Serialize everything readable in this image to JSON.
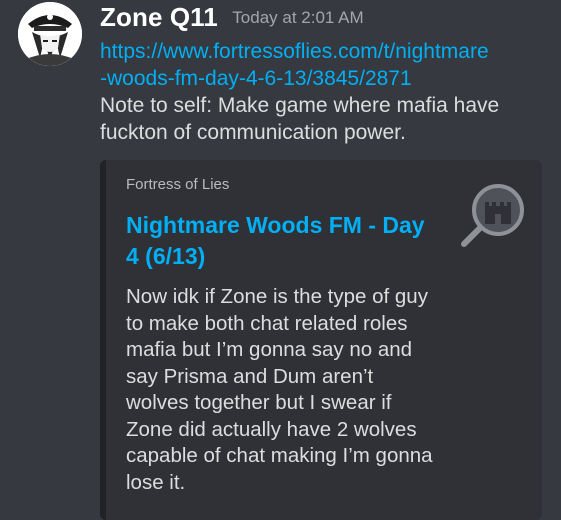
{
  "message": {
    "author": "Zone Q11",
    "timestamp": "Today at 2:01 AM",
    "link_line1": "https://www.fortressoflies.com/t/nightmare",
    "link_line2": "-woods-fm-day-4-6-13/3845/2871",
    "text": "Note to self: Make game where mafia have fuckton of communication power."
  },
  "embed": {
    "provider": "Fortress of Lies",
    "title": "Nightmare Woods FM - Day 4 (6/13)",
    "description": "Now idk if Zone is the type of guy to make both chat related roles mafia but I’m gonna say no and say Prisma and Dum aren’t wolves together but I swear if Zone did actually have 2 wolves capable of chat making I’m gonna lose it.",
    "thumbnail_icon": "castle-magnifier-icon"
  },
  "colors": {
    "background": "#36393f",
    "embed_background": "#2f3136",
    "link": "#00aff4",
    "text": "#dcddde",
    "username": "#ffffff",
    "timestamp": "#a3a6aa"
  }
}
